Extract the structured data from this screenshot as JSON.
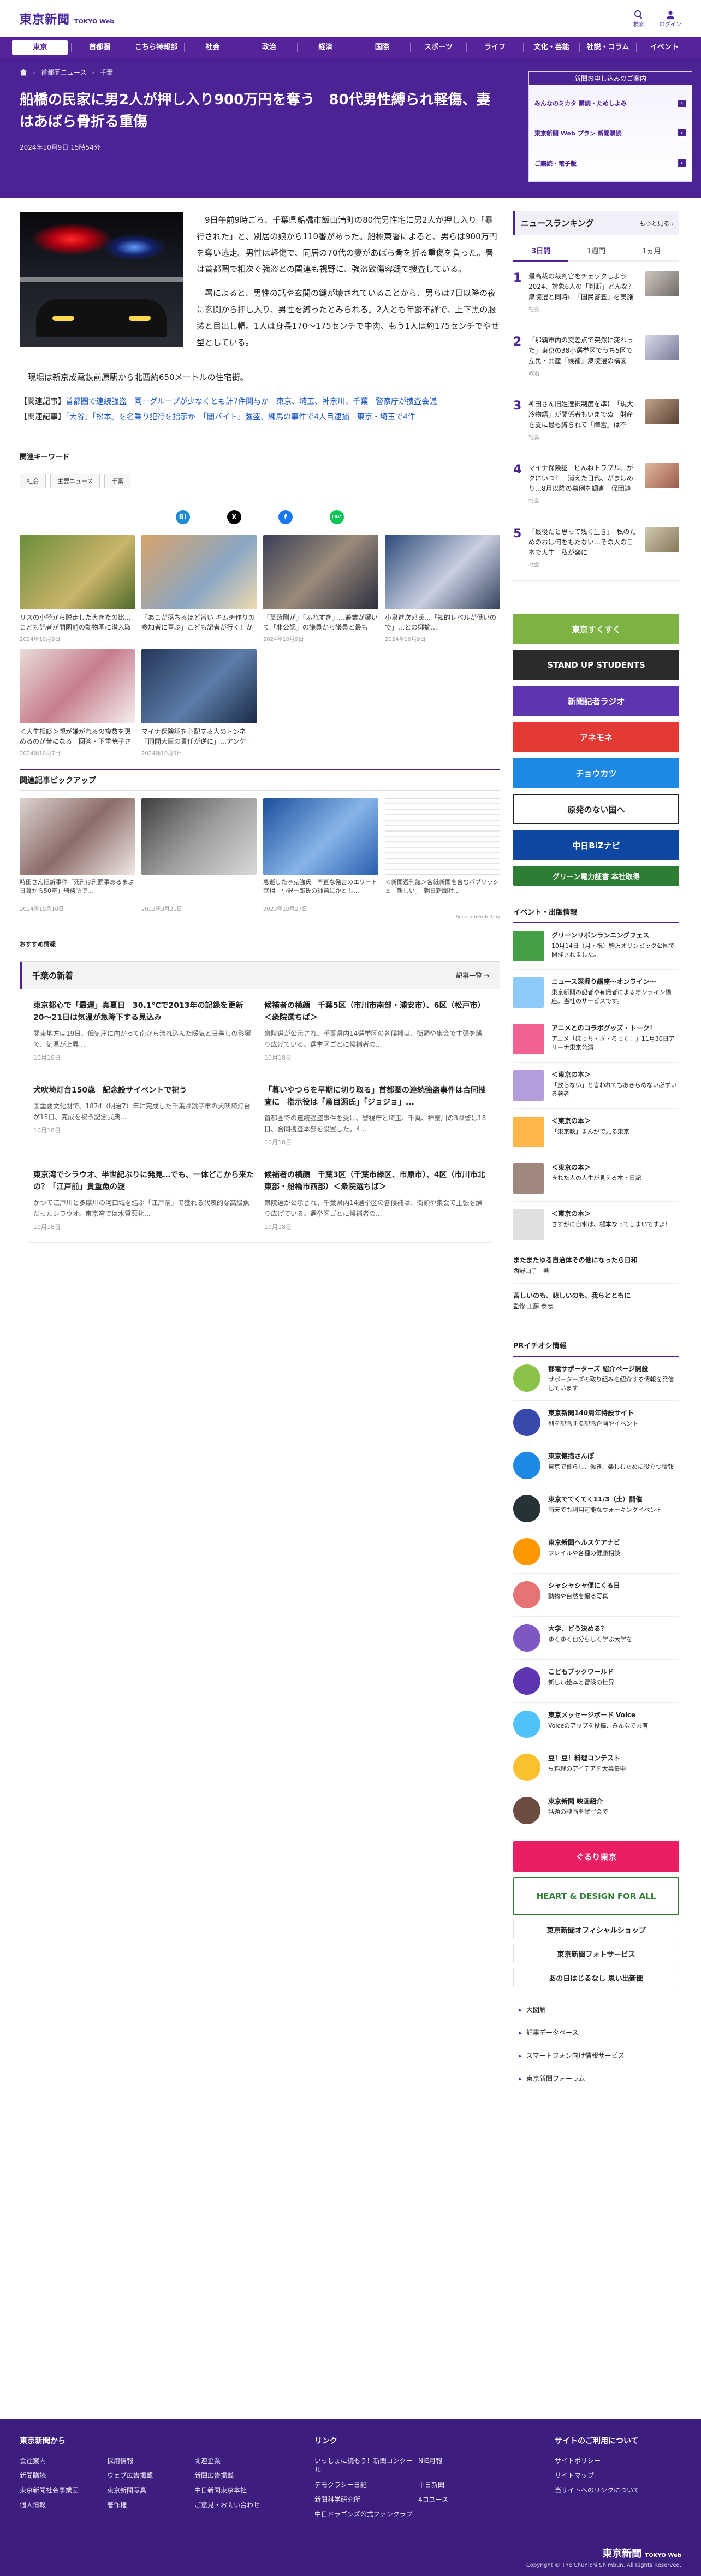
{
  "header": {
    "logo_jp": "東京新聞",
    "logo_en": "TOKYO Web",
    "search_label": "検索",
    "login_label": "ログイン"
  },
  "nav": [
    "東京",
    "首都圏",
    "こちら特報部",
    "社会",
    "政治",
    "経済",
    "国際",
    "スポーツ",
    "ライフ",
    "文化・芸能",
    "社説・コラム",
    "イベント"
  ],
  "nav_active": "東京",
  "breadcrumb": [
    "首都圏ニュース",
    "千葉"
  ],
  "article": {
    "title": "船橋の民家に男2人が押し入り900万円を奪う　80代男性縛られ軽傷、妻はあばら骨折る重傷",
    "date": "2024年10月9日 15時54分",
    "p1": "9日午前9時ごろ、千葉県船橋市飯山満町の80代男性宅に男2人が押し入り「暴行された」と、別居の娘から110番があった。船橋東署によると、男らは900万円を奪い逃走。男性は軽傷で、同居の70代の妻があばら骨を折る重傷を負った。署は首都圏で相次ぐ強盗との関連も視野に、強盗致傷容疑で捜査している。",
    "p2": "署によると、男性の話や玄関の鍵が壊されていることから、男らは7日以降の夜に玄関から押し入り、男性を縛ったとみられる。2人とも年齢不詳で、上下黒の服装と目出し帽。1人は身長170〜175センチで中肉、もう1人は約175センチでやせ型としている。",
    "p3": "現場は新京成電鉄前原駅から北西約650メートルの住宅街。",
    "related": [
      {
        "tag": "【関連記事】",
        "text": "首都圏で連続強盗　同一グループが少なくとも計7件関与か　東京、埼玉、神奈川、千葉　警察庁が捜査会議"
      },
      {
        "tag": "【関連記事】",
        "text": "「大谷」「松本」を名乗り犯行を指示か　「闇バイト」強盗、練馬の事件で4人目逮捕　東京・埼玉で4件"
      }
    ]
  },
  "keywords": {
    "title": "関連キーワード",
    "items": [
      "社会",
      "主要ニュース",
      "千葉"
    ]
  },
  "share": [
    "B!",
    "X",
    "f",
    "LINE"
  ],
  "related_cards": [
    {
      "title": "リスの小径から脱走した大きたの比...こども記者が開園前の動物園に潜入取材",
      "date": "2024年10月9日"
    },
    {
      "title": "「あこが落ちるほど旨い キムチ作りの参加者に喜ぶ」こども記者が行く！かつけわもの"
    },
    {
      "title": "「草薙剛が」「ふれすぎ」…兼業が響いて「非公認」の議員から議員と最も落...下村博...",
      "date": "2024年10月9日"
    },
    {
      "title": "小泉進次郎氏…「知的レベルが低いので」…との揶揄…",
      "date": "2024年10月9日"
    },
    {
      "title": "＜人生相談＞親が嫌がれるの複数を褒めるのが苦になる　回答・下重暁子さん（作家）",
      "date": "2024年10月7日"
    },
    {
      "title": "マイナ保険証を心配する人のトンネ「同開大臣の責任が逆に」…アンケートで続き発言",
      "date": "2024年10月9日"
    }
  ],
  "pickup": {
    "title": "関連記事ピックアップ",
    "items": [
      {
        "title": "時田さん旧訴事件「死刑は刑罰事あるまぶ日暮から50年」刑務所で...",
        "date": "2024年10月10日"
      },
      {
        "title": "",
        "date": "2023年3月21日"
      },
      {
        "title": "急逝した李克強氏　率直な発言のエリート宰相　小沢一郎氏の師弟にかとも…",
        "date": "2023年10月27日"
      },
      {
        "title": "＜新聞週刊誌＞各紙新聞を含むパブリッシュ「新しい」　朝日新聞社..."
      }
    ],
    "credit": "Recommended by"
  },
  "osusume": "おすすめ情報",
  "news": {
    "title": "千葉の新着",
    "more": "記事一覧",
    "items": [
      {
        "h": "東京都心で「最遅」真夏日　30.1℃で2013年の記録を更新　20〜21日は気温が急降下する見込み",
        "b": "関東地方は19日、低気圧に向かって南から流れ込んた暖気と日差しの影響で、気温が上昇...",
        "d": "10月19日"
      },
      {
        "h": "候補者の横顔　千葉5区（市川市南部・浦安市）、6区（松戸市）＜衆院選ちば＞",
        "b": "衆院選が公示され、千葉県内14選挙区の各候補は、街頭や集会で主張を繰り広げている。選挙区ごとに候補者の...",
        "d": "10月18日"
      },
      {
        "h": "犬吠埼灯台150歳　記念設サイベントで祝う",
        "b": "国重要文化財で、1874（明治7）年に完成した千葉県銚子市の犬吠埼灯台が15日、完成を祝う記念式典...",
        "d": "10月18日"
      },
      {
        "h": "「暮いやつらを早期に切り取る」首都圏の連続強盗事件は合同捜査に　指示役は「意目源氏」「ジョジョ」...",
        "b": "首都圏での連続強盗事件を受け、警視庁と埼玉、千葉、神奈川の3県警は18日、合同捜査本部を設置した。4...",
        "d": "10月18日"
      },
      {
        "h": "東京湾でシラウオ、半世紀ぶりに発見…でも、一体どこから来たの？「江戸前」貴重魚の謎",
        "b": "かつて江戸川と多摩川の河口域を結ぶ「江戸前」で獲れる代表的な高級魚だったシラウオ。東京湾では水質悪化...",
        "d": "10月18日"
      },
      {
        "h": "候補者の横顔　千葉3区（千葉市緑区、市原市）、4区（市川市北東部・船橋市西部）＜衆院選ちば＞",
        "b": "衆院選が公示され、千葉県内14選挙区の各候補は、街頭や集会で主張を繰り広げている。選挙区ごとに候補者の...",
        "d": "10月18日"
      }
    ]
  },
  "sidebar": {
    "ad_title": "新聞お申し込みのご案内",
    "ad_rows": [
      "みんなのミカタ 購読・ためしよみ",
      "東京新聞 Web プラン 新聞購読",
      "ご購読・電子版"
    ],
    "ranking_title": "ニュースランキング",
    "ranking_more": "もっと見る",
    "tabs": [
      "3日間",
      "1週間",
      "1ヵ月"
    ],
    "ranking": [
      {
        "t": "最高裁の裁判官をチェックしよう2024、対象6人の「判断」どんな？　衆院選と同時に「国民審査」を実施",
        "c": "社会"
      },
      {
        "t": "「那覇市内の交差点で突然に変わった」東京の38小選挙区でうち5区で立民・共産「候補」衆院選の構図",
        "c": "政治"
      },
      {
        "t": "神田さん旧姓選択制度を準に「規大冷物語」が関係者もいまでぬ　財産を支に最も縛られて「陣営」は不",
        "c": "社会"
      },
      {
        "t": "マイナ保険証　ピんねトラブル、がクにいつ？　消えた日代、がまはめり…8月以降の事例を調査　保団連",
        "c": "社会"
      },
      {
        "t": "「最後だと思って残く生き」　私のためのおは何をもたない…その人の日本で人生　私が楽に",
        "c": "社会"
      }
    ],
    "banners": [
      "東京すくすく",
      "STAND UP STUDENTS",
      "新聞記者ラジオ",
      "アネモネ",
      "チョウカツ",
      "原発のない国へ",
      "中日BiZナビ",
      "グリーン電力証書 本社取得"
    ],
    "events_title": "イベント・出版情報",
    "events": [
      {
        "b": "グリーンリボンランニングフェス",
        "t": "10月14日（月・祝）駒沢オリンピック公園で開催されました。"
      },
      {
        "b": "ニュース深掘り講座〜オンライン〜",
        "t": "東京新聞の記者や有識者によるオンライン講座。当社のサービスです。"
      },
      {
        "b": "アニメとのコラボグッズ・トーク！",
        "t": "アニメ「ぼっち・ざ・ろっく！」11月30日アリーナ東京公演"
      },
      {
        "b": "＜東京の本＞",
        "t": "「放らない」と言われてもあきらめない必ずいる著者"
      },
      {
        "b": "＜東京の本＞",
        "t": "「東京教」まんがで見る東京"
      },
      {
        "b": "＜東京の本＞",
        "t": "きれた人の人生が見える本・日記"
      },
      {
        "b": "＜東京の本＞",
        "t": "さすがに自水は、樋本なってしまいですよ！"
      },
      {
        "b": "またまたゆる自治体その他になったら日和",
        "t": "西野由子　著"
      },
      {
        "b": "苦しいのも、悲しいのも、我らとともに",
        "t": "監修 工藤 泰志"
      }
    ],
    "pr_title": "PRイチオシ情報",
    "pr": [
      {
        "b": "都電サポーターズ 紹介ページ開設",
        "t": "サポーターズの取り組みを紹介する情報を発信しています"
      },
      {
        "b": "東京新聞140周年特設サイト",
        "t": "列を記念する記念企画やイベント"
      },
      {
        "b": "東京懐描さんぽ",
        "t": "東京で暮らし、働き、楽しむために役立つ情報"
      },
      {
        "b": "東京でてくてく11/3（土）開催",
        "t": "雨天でも利用可能なウォーキングイベント"
      },
      {
        "b": "東京新聞ヘルスケアナビ",
        "t": "フレイルや各種の健康相談"
      },
      {
        "b": "シャシャシャ便にくる日",
        "t": "動物や自然を撮る写真"
      },
      {
        "b": "大学、どう決める？",
        "t": "ゆくゆく自分らしく学ぶ大学を"
      },
      {
        "b": "こどもブックワールド",
        "t": "新しい絵本と冒険の世界"
      },
      {
        "b": "東京メッセージボード Voice",
        "t": "Voiceのアップを投稿、みんなで共有"
      },
      {
        "b": "豆！豆！料理コンテスト",
        "t": "豆料理のアイデアを大募集中"
      },
      {
        "b": "東京新聞 映画紹介",
        "t": "話題の映画を試写会で"
      }
    ],
    "pr_banners": [
      "ぐるり東京",
      "HEART & DESIGN FOR ALL",
      "東京新聞オフィシャルショップ",
      "東京新聞フォトサービス",
      "あの日はじるなし 思い出新聞"
    ],
    "links": [
      "大図解",
      "記事データベース",
      "スマートフォン向け情報サービス",
      "東京新聞フォーラム"
    ]
  },
  "footer": {
    "col1_title": "東京新聞から",
    "col1": [
      "会社案内",
      "採用情報",
      "関連企業",
      "新聞購読",
      "ウェブ広告掲載",
      "新聞広告掲載",
      "東京新聞社会事業団",
      "東京新聞写真",
      "中日新聞東京本社",
      "個人情報",
      "著作権",
      "ご意見・お問い合わせ"
    ],
    "col2_title": "リンク",
    "col2": [
      "いっしょに読もう！新聞コンクール",
      "NIE月報",
      "デモクラシー日記",
      "中日新聞",
      "新聞科学研究所",
      "4コユース",
      "中日ドラゴンズ公式ファンクラブ"
    ],
    "col3_title": "サイトのご利用について",
    "col3": [
      "サイトポリシー",
      "サイトマップ",
      "当サイトへのリンクについて"
    ],
    "copyright": "Copyright © The Chunichi Shimbun. All Rights Reserved."
  }
}
